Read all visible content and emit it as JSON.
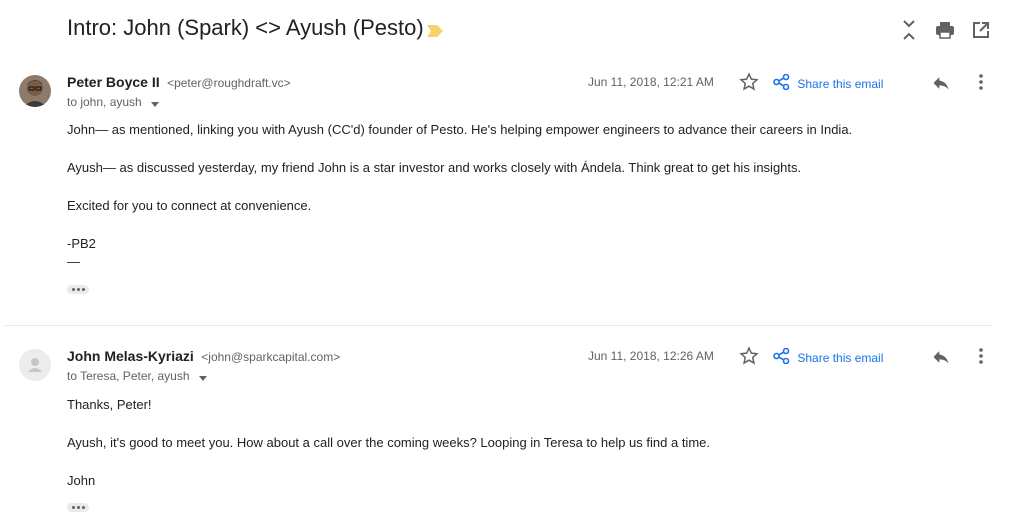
{
  "subject": "Intro: John (Spark) <> Ayush (Pesto)",
  "colors": {
    "accent": "#1a73e8",
    "importance_marker": "#f8d06c",
    "muted_text": "#5f6368",
    "divider": "#e8eaed"
  },
  "toolbar": {
    "icons": [
      "collapse-all-icon",
      "print-icon",
      "open-in-new-window-icon"
    ]
  },
  "messages": [
    {
      "sender_name": "Peter Boyce II",
      "sender_email": "<peter@roughdraft.vc>",
      "recipients": "to john, ayush",
      "date": "Jun 11, 2018, 12:21 AM",
      "share_label": "Share this email",
      "avatar": "photo",
      "body": [
        "John— as mentioned, linking you with Ayush (CC'd) founder of Pesto. He's helping empower engineers to advance their careers in India.",
        "Ayush— as discussed yesterday, my friend John is a star investor and works closely with Ándela. Think great to get his insights.",
        "Excited for you to connect at convenience.",
        "-PB2",
        "—"
      ]
    },
    {
      "sender_name": "John Melas-Kyriazi",
      "sender_email": "<john@sparkcapital.com>",
      "recipients": "to Teresa, Peter, ayush",
      "date": "Jun 11, 2018, 12:26 AM",
      "share_label": "Share this email",
      "avatar": "placeholder-person",
      "body": [
        "Thanks, Peter!",
        "Ayush, it's good to meet you. How about a call over the coming weeks? Looping in Teresa to help us find a time.",
        "John"
      ]
    }
  ]
}
